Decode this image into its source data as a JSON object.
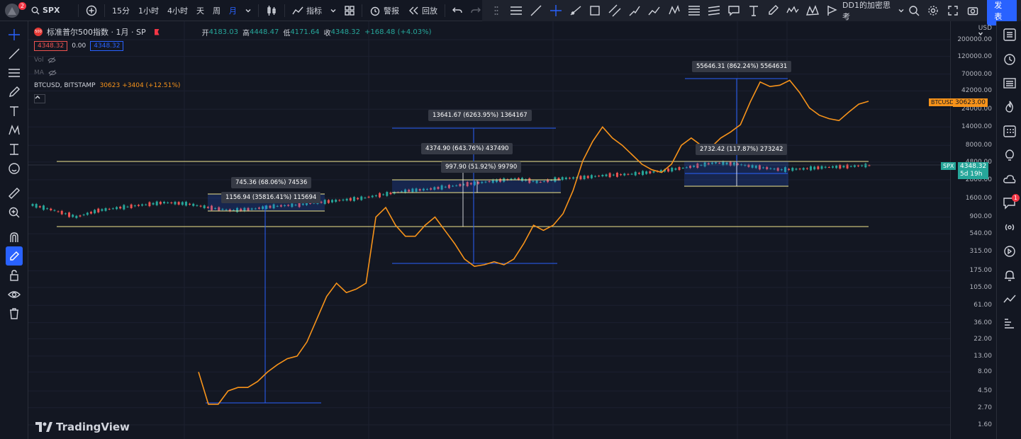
{
  "topbar": {
    "notification_count": "2",
    "symbol": "SPX",
    "intervals": [
      "15分",
      "1小时",
      "4小时",
      "天",
      "周",
      "月"
    ],
    "active_interval": "月",
    "indicators_label": "指标",
    "alert_label": "警报",
    "replay_label": "回放",
    "layout_name": "DD1的加密思考",
    "publish_label": "发表"
  },
  "legend": {
    "title": "标准普尔500指数 · 1月 · SP",
    "open_label": "开",
    "open": "4183.03",
    "high_label": "高",
    "high": "4448.47",
    "low_label": "低",
    "low": "4171.64",
    "close_label": "收",
    "close": "4348.32",
    "change": "+168.48 (+4.03%)",
    "bid": "4348.32",
    "spread": "0.00",
    "ask": "4348.32",
    "vol_label": "Vol",
    "ma_label": "MA",
    "overlay_symbol": "BTCUSD, BITSTAMP",
    "overlay_value": "30623",
    "overlay_change": "+3404 (+12.51%)"
  },
  "price_axis": {
    "currency": "USD",
    "labels": [
      "200000.00",
      "120000.00",
      "70000.00",
      "42000.00",
      "24000.00",
      "14000.00",
      "8000.00",
      "4800.00",
      "2800.00",
      "1600.00",
      "900.00",
      "540.00",
      "315.00",
      "175.00",
      "105.00",
      "61.00",
      "36.00",
      "22.00",
      "13.00",
      "8.00",
      "4.50",
      "2.70",
      "1.60"
    ],
    "btc_tag": "BTCUSD",
    "btc_price": "30623.00",
    "spx_tag": "SPX",
    "spx_price": "4348.32",
    "spx_countdown": "5d 19h"
  },
  "annotations": [
    "55646.31 (862.24%) 5564631",
    "13641.67 (6263.95%) 1364167",
    "4374.90 (643.76%) 437490",
    "997.90 (51.92%) 99790",
    "2732.42 (117.87%) 273242",
    "745.36 (68.06%) 74536",
    "1156.94 (35816.41%) 115694"
  ],
  "watermark": "TradingView",
  "right_toolbar": {
    "notification_count": "1"
  },
  "colors": {
    "background": "#131722",
    "btc_line": "#f7931a",
    "up_candle": "#26a69a",
    "down_candle": "#ef5350",
    "measure_line": "#2962ff",
    "level_line": "#f0e68c",
    "publish_button": "#2962ff"
  },
  "chart_data": {
    "type": "line",
    "title": "标准普尔500指数 · 1月 · SP",
    "y_scale": "log",
    "ylim": [
      1.6,
      200000
    ],
    "series": [
      {
        "name": "BTCUSD",
        "values": [
          8,
          3,
          3,
          4.5,
          5,
          5,
          6,
          8,
          10,
          12,
          13,
          20,
          40,
          80,
          120,
          90,
          100,
          120,
          900,
          1200,
          700,
          500,
          500,
          700,
          900,
          600,
          400,
          250,
          200,
          210,
          230,
          210,
          250,
          400,
          700,
          600,
          700,
          1000,
          2000,
          5000,
          9000,
          14000,
          10000,
          8000,
          6000,
          4500,
          3800,
          3500,
          4500,
          8000,
          10000,
          8000,
          7500,
          10000,
          12000,
          15000,
          30000,
          55000,
          48000,
          50000,
          58000,
          40000,
          25000,
          20000,
          18000,
          17000,
          22000,
          28000,
          30623
        ]
      },
      {
        "name": "SPX",
        "values": [
          1300,
          1100,
          900,
          1100,
          1200,
          1300,
          1400,
          1350,
          1200,
          1100,
          1150,
          1250,
          1300,
          1400,
          1500,
          1600,
          1800,
          2000,
          2100,
          2300,
          2500,
          2700,
          2900,
          2600,
          2900,
          3000,
          3200,
          3300,
          3500,
          3800,
          4200,
          4700,
          4500,
          4100,
          3800,
          3900,
          4100,
          4200,
          4348
        ]
      }
    ]
  }
}
